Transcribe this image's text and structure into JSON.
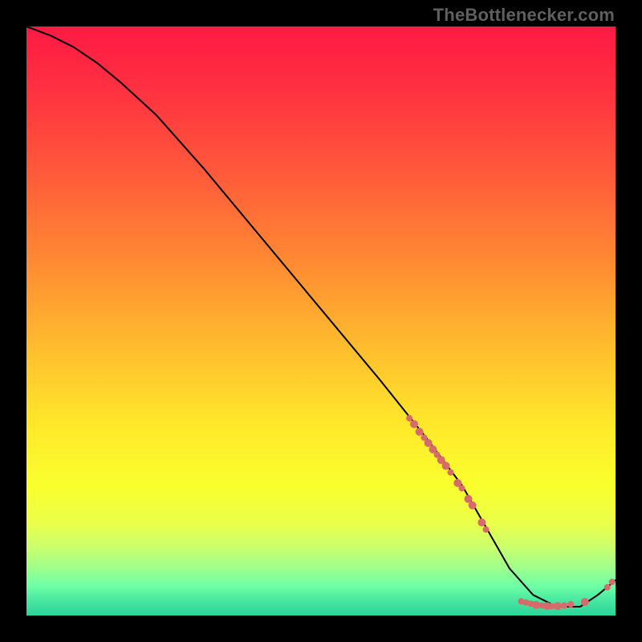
{
  "watermark": "TheBottlenecker.com",
  "gradient_stops": [
    {
      "offset": 0.0,
      "color": "#ff1a44"
    },
    {
      "offset": 0.1,
      "color": "#ff2f41"
    },
    {
      "offset": 0.25,
      "color": "#ff5a3a"
    },
    {
      "offset": 0.4,
      "color": "#ff8a33"
    },
    {
      "offset": 0.55,
      "color": "#ffbf2d"
    },
    {
      "offset": 0.68,
      "color": "#ffe92a"
    },
    {
      "offset": 0.78,
      "color": "#f9ff2d"
    },
    {
      "offset": 0.845,
      "color": "#eaff4a"
    },
    {
      "offset": 0.885,
      "color": "#c9ff6e"
    },
    {
      "offset": 0.92,
      "color": "#9dff8c"
    },
    {
      "offset": 0.95,
      "color": "#6effa6"
    },
    {
      "offset": 0.975,
      "color": "#47e6a1"
    },
    {
      "offset": 1.0,
      "color": "#2fd39a"
    }
  ],
  "chart_data": {
    "type": "line",
    "title": "",
    "xlabel": "",
    "ylabel": "",
    "xlim": [
      0,
      100
    ],
    "ylim": [
      0,
      100
    ],
    "series": [
      {
        "name": "bottleneck-curve",
        "x": [
          0,
          4,
          8,
          12,
          16,
          22,
          30,
          40,
          50,
          60,
          68,
          74,
          78,
          82,
          86,
          90,
          94,
          97,
          100
        ],
        "y": [
          100,
          98.5,
          96.5,
          93.8,
          90.5,
          85,
          76,
          64,
          52,
          40,
          30,
          22,
          15,
          8,
          3.5,
          1.5,
          1.5,
          3.5,
          6
        ]
      }
    ],
    "marker_clusters": [
      {
        "name": "left-descent-cluster",
        "color": "#d76b6b",
        "points": [
          {
            "x": 65.0,
            "y": 33.5,
            "r": 4
          },
          {
            "x": 65.8,
            "y": 32.5,
            "r": 5
          },
          {
            "x": 66.7,
            "y": 31.2,
            "r": 5
          },
          {
            "x": 67.5,
            "y": 30.2,
            "r": 4
          },
          {
            "x": 68.2,
            "y": 29.3,
            "r": 5
          },
          {
            "x": 69.0,
            "y": 28.2,
            "r": 5
          },
          {
            "x": 69.7,
            "y": 27.3,
            "r": 4
          },
          {
            "x": 70.4,
            "y": 26.4,
            "r": 5
          },
          {
            "x": 71.2,
            "y": 25.4,
            "r": 5
          },
          {
            "x": 72.0,
            "y": 24.3,
            "r": 4
          },
          {
            "x": 73.2,
            "y": 22.5,
            "r": 5
          },
          {
            "x": 73.9,
            "y": 21.6,
            "r": 4
          },
          {
            "x": 75.0,
            "y": 19.8,
            "r": 5
          },
          {
            "x": 75.7,
            "y": 18.7,
            "r": 5
          },
          {
            "x": 77.3,
            "y": 15.8,
            "r": 5
          },
          {
            "x": 78.0,
            "y": 14.6,
            "r": 4
          }
        ]
      },
      {
        "name": "valley-cluster",
        "color": "#d76b6b",
        "points": [
          {
            "x": 84.0,
            "y": 2.4,
            "r": 4
          },
          {
            "x": 84.8,
            "y": 2.2,
            "r": 4
          },
          {
            "x": 85.6,
            "y": 2.0,
            "r": 4
          },
          {
            "x": 86.5,
            "y": 1.8,
            "r": 5
          },
          {
            "x": 87.5,
            "y": 1.7,
            "r": 4
          },
          {
            "x": 88.4,
            "y": 1.6,
            "r": 5
          },
          {
            "x": 89.2,
            "y": 1.6,
            "r": 4
          },
          {
            "x": 90.2,
            "y": 1.6,
            "r": 5
          },
          {
            "x": 91.3,
            "y": 1.7,
            "r": 4
          },
          {
            "x": 92.4,
            "y": 1.9,
            "r": 4
          },
          {
            "x": 94.8,
            "y": 2.3,
            "r": 5
          }
        ]
      },
      {
        "name": "right-rise-cluster",
        "color": "#d76b6b",
        "points": [
          {
            "x": 98.6,
            "y": 4.8,
            "r": 4
          },
          {
            "x": 99.4,
            "y": 5.7,
            "r": 4
          }
        ]
      }
    ]
  }
}
